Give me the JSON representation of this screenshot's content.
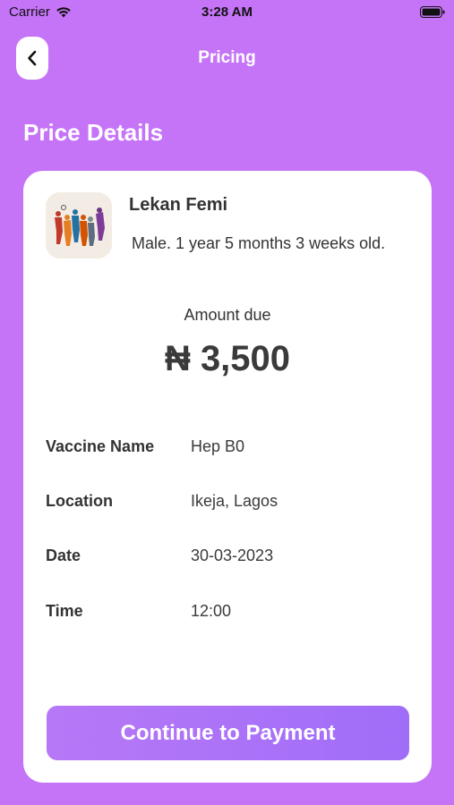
{
  "status_bar": {
    "carrier": "Carrier",
    "time": "3:28 AM"
  },
  "nav": {
    "title": "Pricing",
    "back_icon": "chevron-left-icon"
  },
  "section_title": "Price Details",
  "patient": {
    "name": "Lekan Femi",
    "info": "Male. 1 year 5 months 3 weeks old."
  },
  "amount": {
    "label": "Amount due",
    "value": "₦ 3,500"
  },
  "details": [
    {
      "label": "Vaccine Name",
      "value": "Hep B0"
    },
    {
      "label": "Location",
      "value": "Ikeja, Lagos"
    },
    {
      "label": "Date",
      "value": "30-03-2023"
    },
    {
      "label": "Time",
      "value": "12:00"
    }
  ],
  "pay_button": {
    "label": "Continue to Payment"
  },
  "colors": {
    "background": "#c574f7",
    "card": "#ffffff",
    "button_start": "#b778f7",
    "button_end": "#a06df8"
  }
}
